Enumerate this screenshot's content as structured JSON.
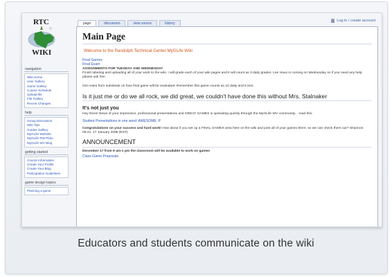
{
  "header": {
    "user_links": "Log in / create account"
  },
  "logo": {
    "top_text": "RTC",
    "bottom_text": "WIKI"
  },
  "tabs": [
    {
      "label": "page",
      "active": true
    },
    {
      "label": "discussion",
      "active": false
    },
    {
      "label": "view source",
      "active": false
    },
    {
      "label": "history",
      "active": false
    }
  ],
  "sidebar": {
    "navigation": {
      "title": "navigation",
      "items": [
        "Wiki Home",
        "User Gallery",
        "Game Gallery",
        "Course Schedule",
        "Upload file",
        "File Gallery",
        "Recent Changes"
      ]
    },
    "help": {
      "title": "help",
      "items": [
        "Group Discussion",
        "Wiki Tips",
        "Guides Gallery",
        "MyGLife Website",
        "MyGLife RW Plato",
        "MyGLife WV Blog"
      ]
    },
    "getting_started": {
      "title": "getting started",
      "items": [
        "Course Information",
        "Create Your Profile",
        "Create Your Blog",
        "Participation Guidelines"
      ]
    },
    "game_design": {
      "title": "game design topics",
      "items": [
        "Planning a game"
      ]
    }
  },
  "main": {
    "title": "Main Page",
    "welcome": "Welcome to the Randolph Technical Center MyGLife Wiki",
    "links": [
      "Final Games",
      "Final Exam"
    ],
    "assignments_heading": "ASSIGNMENTS FOR TUESDAY AND WEDNESDAY",
    "assignments_text": "Finish labeling and uploading all of your work to the wiki. I will grade each of your wiki pages and it will count as 3 daily grades. Lee Haus is coming on Wednesday so if you need any help please ask him.",
    "notes_text": "Get notes from substitute on how final game will be evaluated. Remember this game counts as 10 daily and 6 test.",
    "rock_heading": "Is it just me or do we all rock, we did great, we couldn't have done this without Mrs. Stalnaker",
    "not_just_you_heading": "It's not just you",
    "news_text": "Hey there! News of your impressive, professional presentations and GREAT GAMES is spreading quickly through the MyGLife WV community... read this:",
    "presentations_link": "Student Presentations in one word: AWESOME :P",
    "congrats_bold": "Congratulations on your success and hard work!",
    "congrats_text": "How about if you set up a FINAL GAMES area here on the wiki and post all of your games there, so we can check them out? Shannon 08:41, 17 January 2008 (EST)",
    "announcement_heading": "ANNOUNCEMENT",
    "announcement_text": "December 17 from 9 am-1 pm the classroom will be available to work on games",
    "proposals_link": "Class Game Proposals"
  },
  "caption": "Educators and students communicate on the wiki"
}
